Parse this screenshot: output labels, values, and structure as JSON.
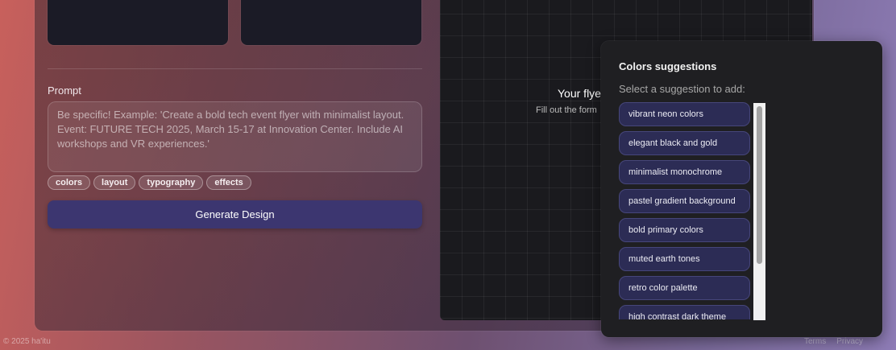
{
  "form": {
    "prompt_label": "Prompt",
    "prompt_placeholder": "Be specific! Example: 'Create a bold tech event flyer with minimalist layout. Event: FUTURE TECH 2025, March 15-17 at Innovation Center. Include AI workshops and VR experiences.'",
    "chips": [
      "colors",
      "layout",
      "typography",
      "effects"
    ],
    "generate_label": "Generate Design"
  },
  "preview": {
    "title": "Your flye",
    "subtitle": "Fill out the form"
  },
  "popup": {
    "title": "Colors suggestions",
    "subtitle": "Select a suggestion to add:",
    "suggestions": [
      "vibrant neon colors",
      "elegant black and gold",
      "minimalist monochrome",
      "pastel gradient background",
      "bold primary colors",
      "muted earth tones",
      "retro color palette",
      "high contrast dark theme"
    ]
  },
  "footer": {
    "copyright": "© 2025 ha'itu",
    "terms": "Terms",
    "privacy": "Privacy"
  }
}
